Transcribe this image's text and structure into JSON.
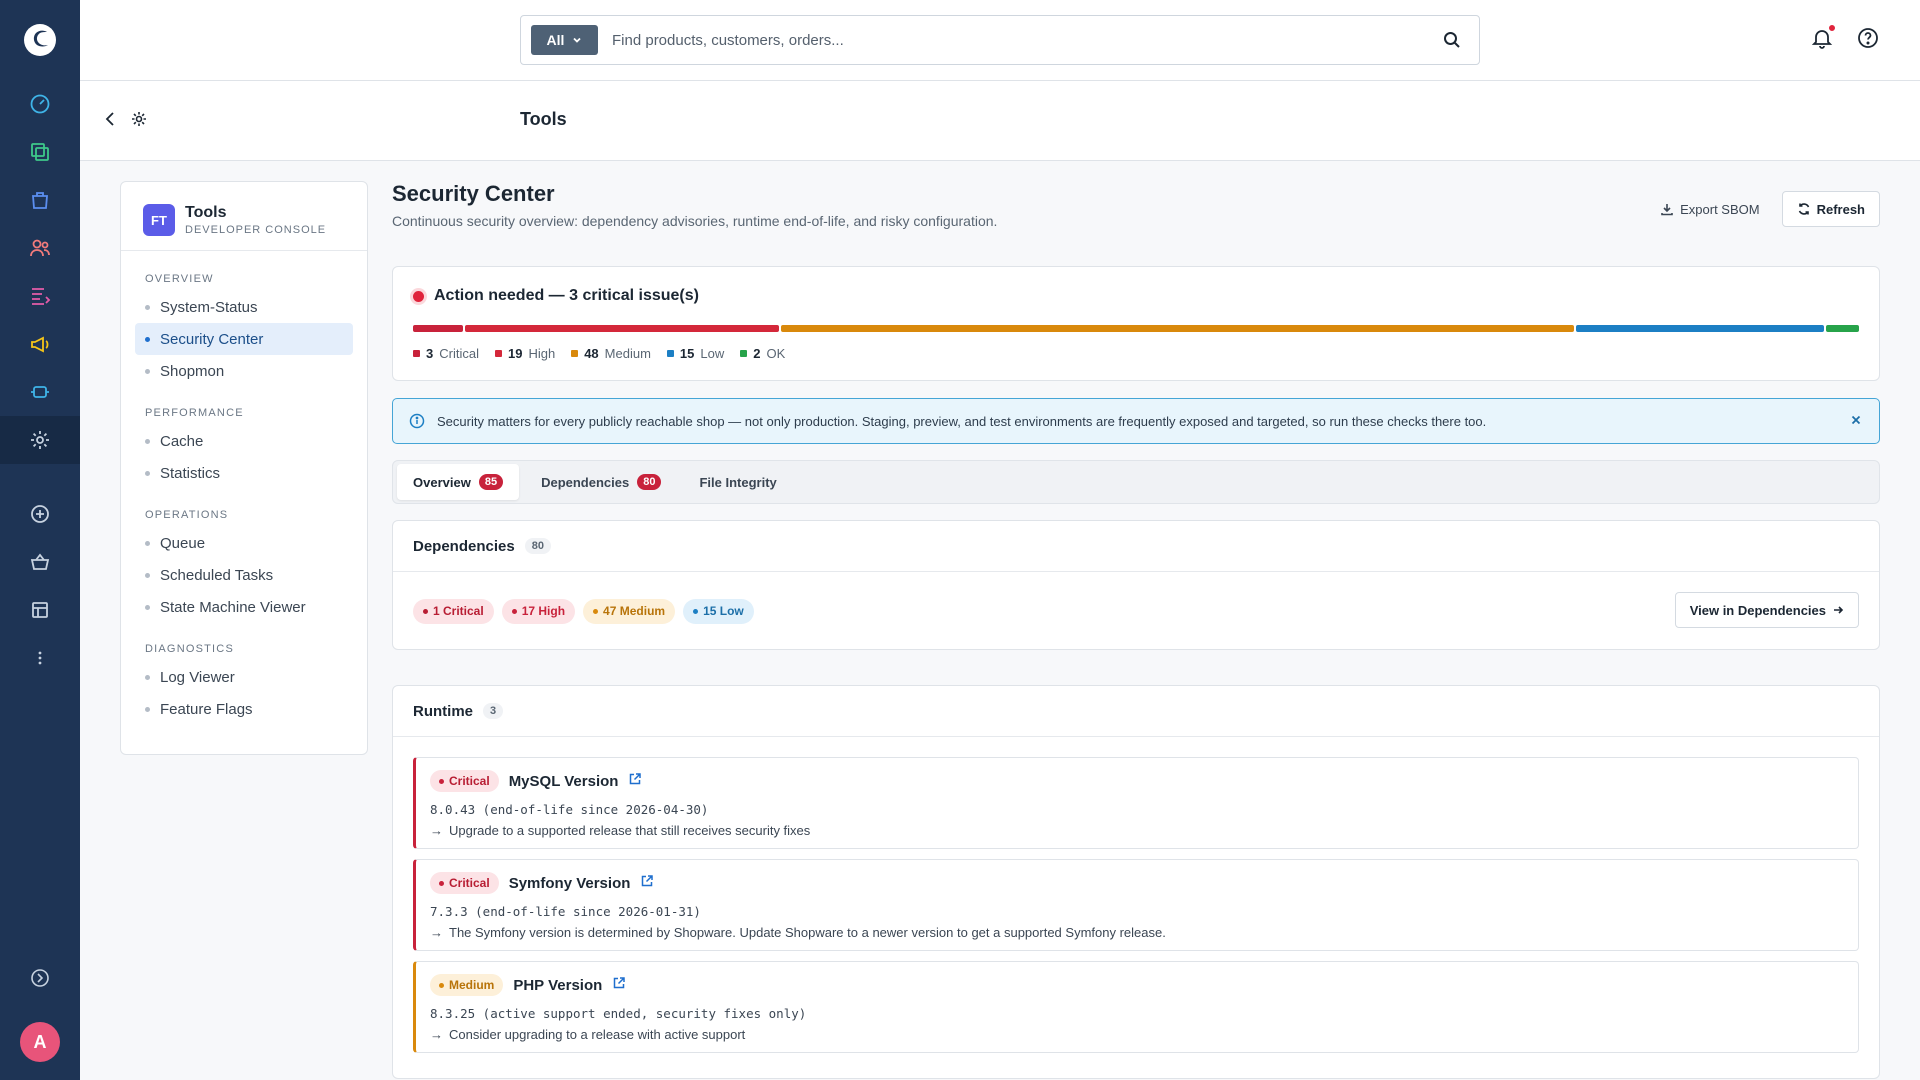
{
  "search": {
    "scope": "All",
    "placeholder": "Find products, customers, orders..."
  },
  "smartbar": {
    "title": "Tools"
  },
  "user": {
    "avatar_initial": "A"
  },
  "sidebar": {
    "badge": "FT",
    "title": "Tools",
    "subtitle": "DEVELOPER CONSOLE",
    "sections": [
      {
        "label": "OVERVIEW",
        "items": [
          "System-Status",
          "Security Center",
          "Shopmon"
        ]
      },
      {
        "label": "PERFORMANCE",
        "items": [
          "Cache",
          "Statistics"
        ]
      },
      {
        "label": "OPERATIONS",
        "items": [
          "Queue",
          "Scheduled Tasks",
          "State Machine Viewer"
        ]
      },
      {
        "label": "DIAGNOSTICS",
        "items": [
          "Log Viewer",
          "Feature Flags"
        ]
      }
    ],
    "active_item": "Security Center"
  },
  "page": {
    "title": "Security Center",
    "subtitle": "Continuous security overview: dependency advisories, runtime end-of-life, and risky configuration.",
    "export_label": "Export SBOM",
    "refresh_label": "Refresh"
  },
  "status": {
    "title": "Action needed — 3 critical issue(s)",
    "segments": [
      {
        "name": "Critical",
        "count": "3",
        "color": "#c8223b"
      },
      {
        "name": "High",
        "count": "19",
        "color": "#d4283a"
      },
      {
        "name": "Medium",
        "count": "48",
        "color": "#d9890c"
      },
      {
        "name": "Low",
        "count": "15",
        "color": "#1c7fc4"
      },
      {
        "name": "OK",
        "count": "2",
        "color": "#27a34a"
      }
    ]
  },
  "info": {
    "text": "Security matters for every publicly reachable shop — not only production. Staging, preview, and test environments are frequently exposed and targeted, so run these checks there too."
  },
  "tabs": [
    {
      "label": "Overview",
      "count": "85"
    },
    {
      "label": "Dependencies",
      "count": "80"
    },
    {
      "label": "File Integrity",
      "count": ""
    }
  ],
  "dependencies": {
    "title": "Dependencies",
    "count": "80",
    "pills": {
      "critical": "1 Critical",
      "high": "17 High",
      "medium": "47 Medium",
      "low": "15 Low"
    },
    "view_label": "View in Dependencies"
  },
  "runtime": {
    "title": "Runtime",
    "count": "3",
    "items": [
      {
        "severity": "Critical",
        "name": "MySQL Version",
        "detail": "8.0.43 (end-of-life since 2026-04-30)",
        "hint": "Upgrade to a supported release that still receives security fixes"
      },
      {
        "severity": "Critical",
        "name": "Symfony Version",
        "detail": "7.3.3 (end-of-life since 2026-01-31)",
        "hint": "The Symfony version is determined by Shopware. Update Shopware to a newer version to get a supported Symfony release."
      },
      {
        "severity": "Medium",
        "name": "PHP Version",
        "detail": "8.3.25 (active support ended, security fixes only)",
        "hint": "Consider upgrading to a release with active support"
      }
    ]
  }
}
